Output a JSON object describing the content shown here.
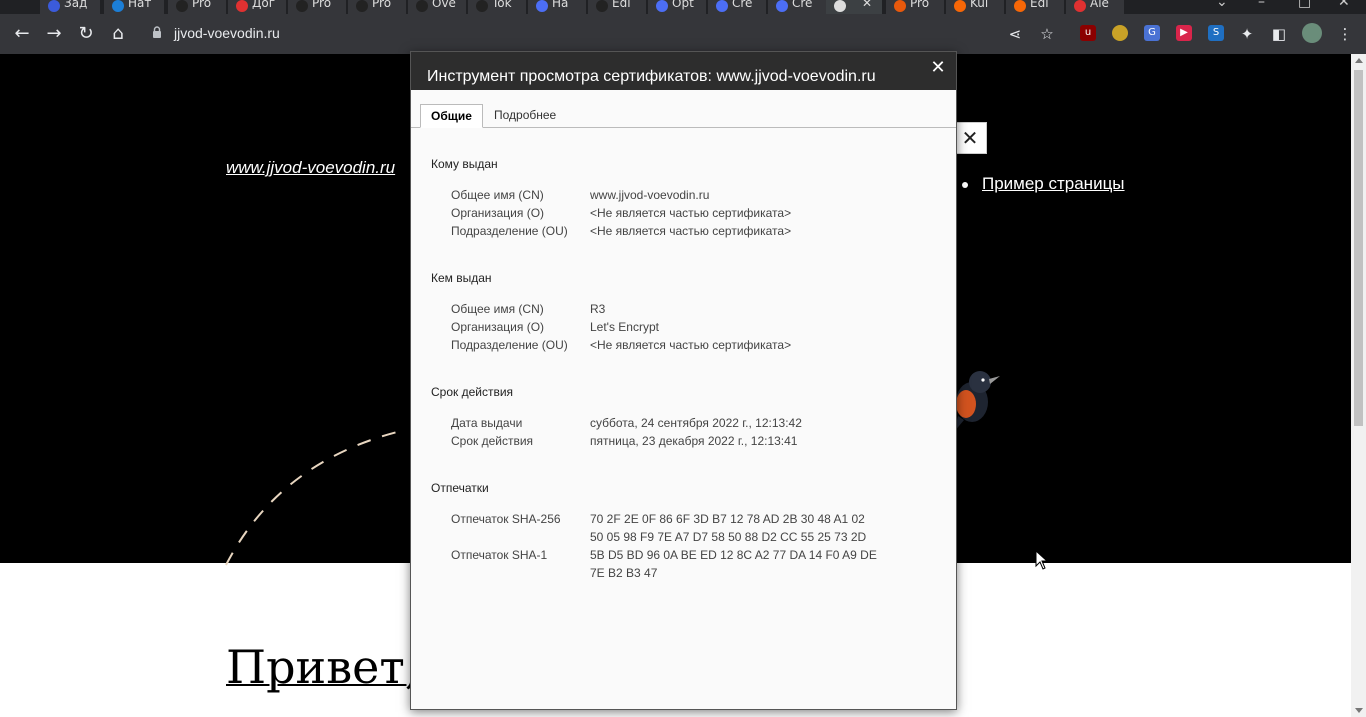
{
  "browser": {
    "tabs": [
      "Зад",
      "Нат",
      "Pro",
      "Дог",
      "Pro",
      "Pro",
      "Ove",
      "Tok",
      "На",
      "Edi",
      "Opt",
      "Cre",
      "Cre",
      "",
      "Pro",
      "Kul",
      "Edi",
      "Ale"
    ],
    "url": "jjvod-voevodin.ru"
  },
  "page": {
    "site_link": "www.jjvod-voevodin.ru",
    "nav_item": "Пример страницы",
    "menu_close": "✕",
    "heading": "Привет, м"
  },
  "dialog": {
    "title": "Инструмент просмотра сертификатов: www.jjvod-voevodin.ru",
    "close": "✕",
    "tabs": {
      "general": "Общие",
      "details": "Подробнее"
    },
    "issued_to": {
      "heading": "Кому выдан",
      "cn_label": "Общее имя (CN)",
      "cn_value": "www.jjvod-voevodin.ru",
      "o_label": "Организация (O)",
      "o_value": "<Не является частью сертификата>",
      "ou_label": "Подразделение (OU)",
      "ou_value": "<Не является частью сертификата>"
    },
    "issued_by": {
      "heading": "Кем выдан",
      "cn_label": "Общее имя (CN)",
      "cn_value": "R3",
      "o_label": "Организация (O)",
      "o_value": "Let's Encrypt",
      "ou_label": "Подразделение (OU)",
      "ou_value": "<Не является частью сертификата>"
    },
    "validity": {
      "heading": "Срок действия",
      "issued_label": "Дата выдачи",
      "issued_value": "суббота, 24 сентября 2022 г., 12:13:42",
      "expires_label": "Срок действия",
      "expires_value": "пятница, 23 декабря 2022 г., 12:13:41"
    },
    "fingerprints": {
      "heading": "Отпечатки",
      "sha256_label": "Отпечаток SHA-256",
      "sha256_line1": "70 2F 2E 0F 86 6F 3D B7 12 78 AD 2B 30 48 A1 02",
      "sha256_line2": "50 05 98 F9 7E A7 D7 58 50 88 D2 CC 55 25 73 2D",
      "sha1_label": "Отпечаток SHA-1",
      "sha1_line1": "5B D5 BD 96 0A BE ED 12 8C A2 77 DA 14 F0 A9 DE",
      "sha1_line2": "7E B2 B3 47"
    }
  }
}
